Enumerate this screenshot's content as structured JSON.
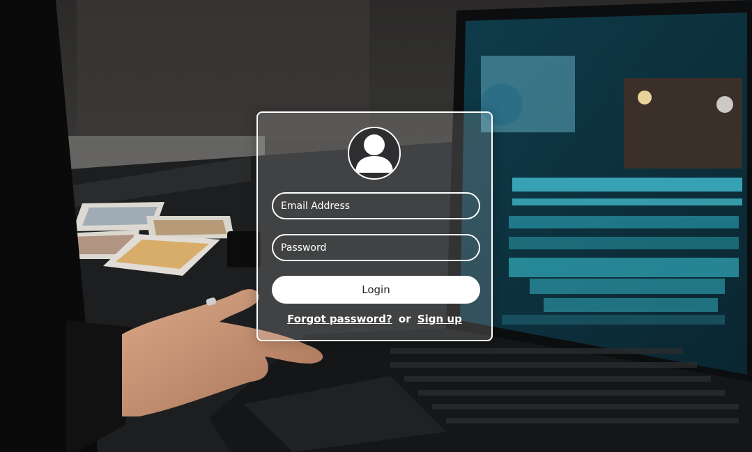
{
  "login": {
    "email_placeholder": "Email Address",
    "password_placeholder": "Password",
    "login_label": "Login",
    "forgot_label": "Forgot password?",
    "or_label": "or",
    "signup_label": "Sign up"
  },
  "icons": {
    "avatar": "user-silhouette-icon"
  },
  "colors": {
    "card_border": "#ffffff",
    "button_bg": "#ffffff",
    "button_text": "#222222",
    "link_text": "#ffffff"
  }
}
